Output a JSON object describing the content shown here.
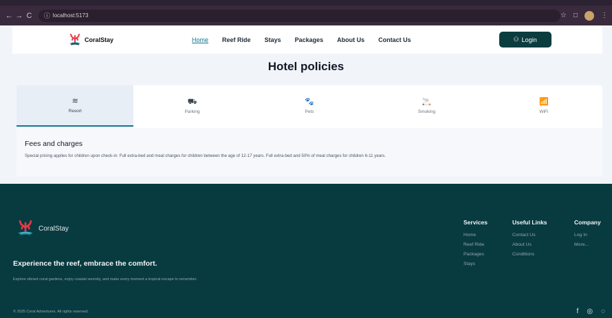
{
  "browser": {
    "url": "localhost:5173",
    "nav": [
      "←",
      "→",
      "C"
    ]
  },
  "navbar": {
    "brand": "CoralStay",
    "links": [
      "Home",
      "Reef Ride",
      "Stays",
      "Packages",
      "About Us",
      "Contact Us"
    ],
    "login_label": "Login"
  },
  "page": {
    "title": "Hotel policies"
  },
  "policy_tabs": [
    {
      "label": "Resort",
      "icon": "≋"
    },
    {
      "label": "Parking",
      "icon": "⛟"
    },
    {
      "label": "Pets",
      "icon": "🐾"
    },
    {
      "label": "Smoking",
      "icon": "🚬"
    },
    {
      "label": "WiFi",
      "icon": "📶"
    }
  ],
  "fees": {
    "heading": "Fees and charges",
    "text": "Special pricing applies for children upon check-in: Full extra-bed and meal charges for children between the age of 12-17 years. Full extra-bed and 50% of meal charges for children 6-11 years."
  },
  "footer": {
    "brand": "CoralStay",
    "tagline": "Experience the reef, embrace the comfort.",
    "description": "Explore vibrant coral gardens, enjoy coastal serenity, and make every moment a tropical escape to remember.",
    "copyright": "© 2025 Coral Adventures. All rights reserved.",
    "columns": [
      {
        "heading": "Services",
        "links": [
          "Home",
          "Reef Ride",
          "Packages",
          "Stays"
        ]
      },
      {
        "heading": "Useful Links",
        "links": [
          "Contact Us",
          "About Us",
          "Conditions"
        ]
      },
      {
        "heading": "Company",
        "links": [
          "Log In",
          "More..."
        ]
      }
    ]
  },
  "colors": {
    "accent": "#0e7490",
    "footer_bg": "#073b40",
    "login_bg": "#0b3d3f",
    "coral_red": "#e63946"
  }
}
